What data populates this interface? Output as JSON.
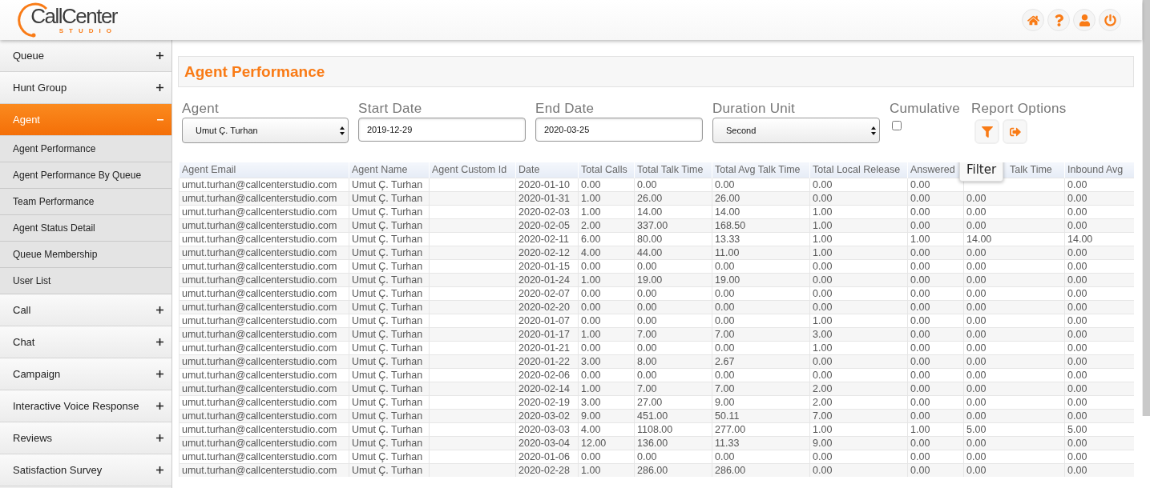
{
  "logo": {
    "name": "CallCenter",
    "tagline": "STUDIO"
  },
  "sidebar": {
    "items": [
      {
        "label": "Queue",
        "selected": false,
        "expanded": false
      },
      {
        "label": "Hunt Group",
        "selected": false,
        "expanded": false
      },
      {
        "label": "Agent",
        "selected": true,
        "expanded": true,
        "children": [
          {
            "label": "Agent Performance",
            "selected": false
          },
          {
            "label": "Agent Performance By Queue",
            "selected": false
          },
          {
            "label": "Team Performance",
            "selected": false
          },
          {
            "label": "Agent Status Detail",
            "selected": false
          },
          {
            "label": "Queue Membership",
            "selected": false
          },
          {
            "label": "User List",
            "selected": false
          }
        ]
      },
      {
        "label": "Call",
        "selected": false,
        "expanded": false
      },
      {
        "label": "Chat",
        "selected": false,
        "expanded": false
      },
      {
        "label": "Campaign",
        "selected": false,
        "expanded": false
      },
      {
        "label": "Interactive Voice Response",
        "selected": false,
        "expanded": false
      },
      {
        "label": "Reviews",
        "selected": false,
        "expanded": false
      },
      {
        "label": "Satisfaction Survey",
        "selected": false,
        "expanded": false
      }
    ]
  },
  "page_title": "Agent Performance",
  "filters": [
    {
      "kind": "select",
      "label": "Agent",
      "value": "Umut Ç. Turhan"
    },
    {
      "kind": "input",
      "label": "Start Date",
      "value": "2019-12-29"
    },
    {
      "kind": "input",
      "label": "End Date",
      "value": "2020-03-25"
    },
    {
      "kind": "select",
      "label": "Duration Unit",
      "value": "Second"
    },
    {
      "kind": "checkbox",
      "label": "Cumulative",
      "checked": false
    },
    {
      "kind": "options",
      "label": "Report Options"
    }
  ],
  "tooltip": "Filter",
  "table": {
    "columns": [
      "Agent Email",
      "Agent Name",
      "Agent Custom Id",
      "Date",
      "Total Calls",
      "Total Talk Time",
      "Total Avg Talk Time",
      "Total Local Release",
      "Answered",
      "Talk Time",
      "Inbound Avg"
    ],
    "rows": [
      [
        "umut.turhan@callcenterstudio.com",
        "Umut Ç. Turhan",
        null,
        "2020-01-10",
        "0.00",
        "0.00",
        "0.00",
        "0.00",
        "0.00",
        null,
        "0.00"
      ],
      [
        "umut.turhan@callcenterstudio.com",
        "Umut Ç. Turhan",
        null,
        "2020-01-31",
        "1.00",
        "26.00",
        "26.00",
        "0.00",
        "0.00",
        "0.00",
        "0.00"
      ],
      [
        "umut.turhan@callcenterstudio.com",
        "Umut Ç. Turhan",
        null,
        "2020-02-03",
        "1.00",
        "14.00",
        "14.00",
        "1.00",
        "0.00",
        "0.00",
        "0.00"
      ],
      [
        "umut.turhan@callcenterstudio.com",
        "Umut Ç. Turhan",
        null,
        "2020-02-05",
        "2.00",
        "337.00",
        "168.50",
        "1.00",
        "0.00",
        "0.00",
        "0.00"
      ],
      [
        "umut.turhan@callcenterstudio.com",
        "Umut Ç. Turhan",
        null,
        "2020-02-11",
        "6.00",
        "80.00",
        "13.33",
        "1.00",
        "1.00",
        "14.00",
        "14.00"
      ],
      [
        "umut.turhan@callcenterstudio.com",
        "Umut Ç. Turhan",
        null,
        "2020-02-12",
        "4.00",
        "44.00",
        "11.00",
        "1.00",
        "0.00",
        "0.00",
        "0.00"
      ],
      [
        "umut.turhan@callcenterstudio.com",
        "Umut Ç. Turhan",
        null,
        "2020-01-15",
        "0.00",
        "0.00",
        "0.00",
        "0.00",
        "0.00",
        "0.00",
        "0.00"
      ],
      [
        "umut.turhan@callcenterstudio.com",
        "Umut Ç. Turhan",
        null,
        "2020-01-24",
        "1.00",
        "19.00",
        "19.00",
        "0.00",
        "0.00",
        "0.00",
        "0.00"
      ],
      [
        "umut.turhan@callcenterstudio.com",
        "Umut Ç. Turhan",
        null,
        "2020-02-07",
        "0.00",
        "0.00",
        "0.00",
        "0.00",
        "0.00",
        "0.00",
        "0.00"
      ],
      [
        "umut.turhan@callcenterstudio.com",
        "Umut Ç. Turhan",
        null,
        "2020-02-20",
        "0.00",
        "0.00",
        "0.00",
        "0.00",
        "0.00",
        "0.00",
        "0.00"
      ],
      [
        "umut.turhan@callcenterstudio.com",
        "Umut Ç. Turhan",
        null,
        "2020-01-07",
        "0.00",
        "0.00",
        "0.00",
        "1.00",
        "0.00",
        "0.00",
        "0.00"
      ],
      [
        "umut.turhan@callcenterstudio.com",
        "Umut Ç. Turhan",
        null,
        "2020-01-17",
        "1.00",
        "7.00",
        "7.00",
        "3.00",
        "0.00",
        "0.00",
        "0.00"
      ],
      [
        "umut.turhan@callcenterstudio.com",
        "Umut Ç. Turhan",
        null,
        "2020-01-21",
        "0.00",
        "0.00",
        "0.00",
        "1.00",
        "0.00",
        "0.00",
        "0.00"
      ],
      [
        "umut.turhan@callcenterstudio.com",
        "Umut Ç. Turhan",
        null,
        "2020-01-22",
        "3.00",
        "8.00",
        "2.67",
        "0.00",
        "0.00",
        "0.00",
        "0.00"
      ],
      [
        "umut.turhan@callcenterstudio.com",
        "Umut Ç. Turhan",
        null,
        "2020-02-06",
        "0.00",
        "0.00",
        "0.00",
        "0.00",
        "0.00",
        "0.00",
        "0.00"
      ],
      [
        "umut.turhan@callcenterstudio.com",
        "Umut Ç. Turhan",
        null,
        "2020-02-14",
        "1.00",
        "7.00",
        "7.00",
        "2.00",
        "0.00",
        "0.00",
        "0.00"
      ],
      [
        "umut.turhan@callcenterstudio.com",
        "Umut Ç. Turhan",
        null,
        "2020-02-19",
        "3.00",
        "27.00",
        "9.00",
        "2.00",
        "0.00",
        "0.00",
        "0.00"
      ],
      [
        "umut.turhan@callcenterstudio.com",
        "Umut Ç. Turhan",
        null,
        "2020-03-02",
        "9.00",
        "451.00",
        "50.11",
        "7.00",
        "0.00",
        "0.00",
        "0.00"
      ],
      [
        "umut.turhan@callcenterstudio.com",
        "Umut Ç. Turhan",
        null,
        "2020-03-03",
        "4.00",
        "1108.00",
        "277.00",
        "1.00",
        "1.00",
        "5.00",
        "5.00"
      ],
      [
        "umut.turhan@callcenterstudio.com",
        "Umut Ç. Turhan",
        null,
        "2020-03-04",
        "12.00",
        "136.00",
        "11.33",
        "9.00",
        "0.00",
        "0.00",
        "0.00"
      ],
      [
        "umut.turhan@callcenterstudio.com",
        "Umut Ç. Turhan",
        null,
        "2020-01-06",
        "0.00",
        "0.00",
        "0.00",
        "0.00",
        "0.00",
        "0.00",
        "0.00"
      ],
      [
        "umut.turhan@callcenterstudio.com",
        "Umut Ç. Turhan",
        null,
        "2020-02-28",
        "1.00",
        "286.00",
        "286.00",
        "0.00",
        "0.00",
        "0.00",
        "0.00"
      ]
    ]
  }
}
